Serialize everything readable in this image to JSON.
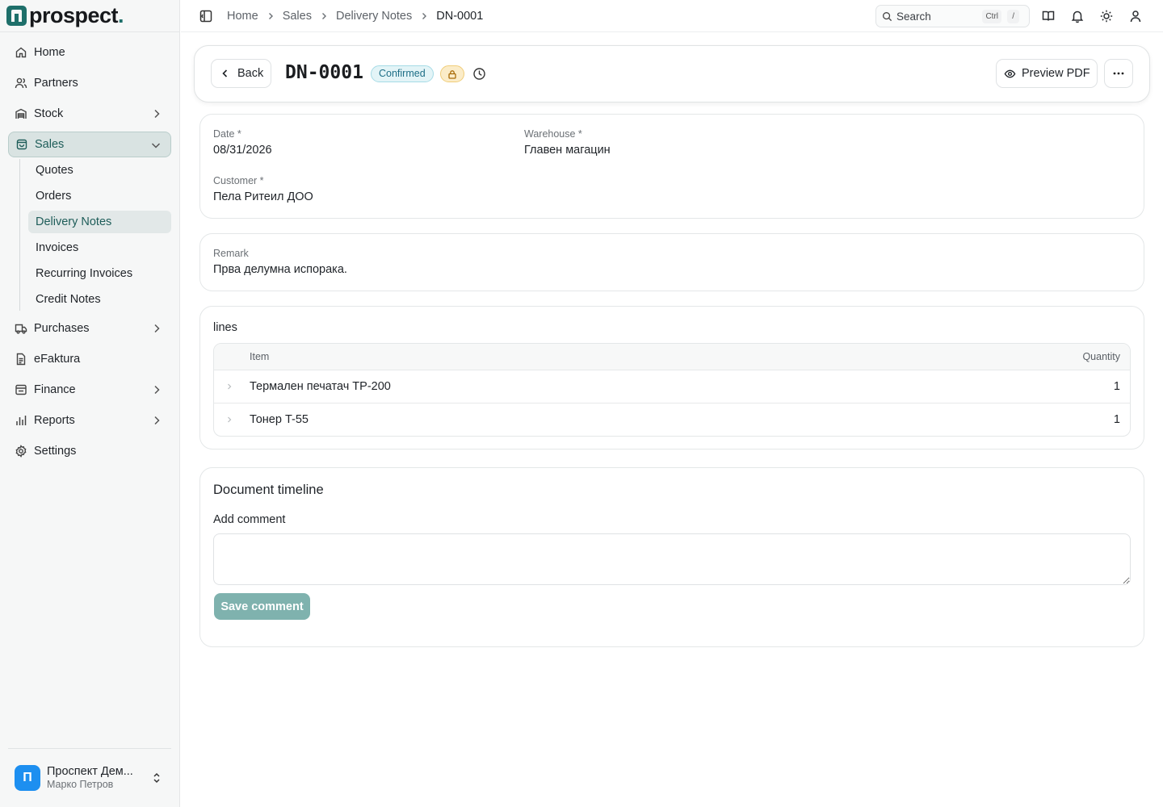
{
  "brand": {
    "name": "prospect",
    "dot": "."
  },
  "sidebar": {
    "items": [
      {
        "label": "Home"
      },
      {
        "label": "Partners"
      },
      {
        "label": "Stock"
      },
      {
        "label": "Sales"
      },
      {
        "label": "Purchases"
      },
      {
        "label": "eFaktura"
      },
      {
        "label": "Finance"
      },
      {
        "label": "Reports"
      },
      {
        "label": "Settings"
      }
    ],
    "sales_sub": [
      {
        "label": "Quotes"
      },
      {
        "label": "Orders"
      },
      {
        "label": "Delivery Notes"
      },
      {
        "label": "Invoices"
      },
      {
        "label": "Recurring Invoices"
      },
      {
        "label": "Credit Notes"
      }
    ]
  },
  "account": {
    "initial": "П",
    "name": "Проспект Дем...",
    "user": "Марко Петров"
  },
  "topbar": {
    "breadcrumb": [
      "Home",
      "Sales",
      "Delivery Notes",
      "DN-0001"
    ],
    "search_placeholder": "Search",
    "kbd_ctrl": "Ctrl",
    "kbd_slash": "/"
  },
  "header": {
    "back_label": "Back",
    "doc_number": "DN-0001",
    "status": "Confirmed",
    "preview_label": "Preview PDF",
    "more_label": "···"
  },
  "details": {
    "date_label": "Date *",
    "date_value": "08/31/2026",
    "warehouse_label": "Warehouse *",
    "warehouse_value": "Главен магацин",
    "customer_label": "Customer *",
    "customer_value": "Пела Ритеил ДОО"
  },
  "remark": {
    "label": "Remark",
    "value": "Прва делумна испорака."
  },
  "lines": {
    "title": "lines",
    "columns": {
      "item": "Item",
      "quantity": "Quantity"
    },
    "rows": [
      {
        "item": "Термален печатач TP-200",
        "quantity": "1"
      },
      {
        "item": "Тонер T-55",
        "quantity": "1"
      }
    ]
  },
  "timeline": {
    "title": "Document timeline",
    "add_comment_label": "Add comment",
    "comment_value": "",
    "save_label": "Save comment"
  },
  "colors": {
    "accent": "#1e6f6a",
    "status_badge": "#e3f4f7",
    "lock_badge": "#fbecc8",
    "save_button": "#7fb2ae"
  }
}
